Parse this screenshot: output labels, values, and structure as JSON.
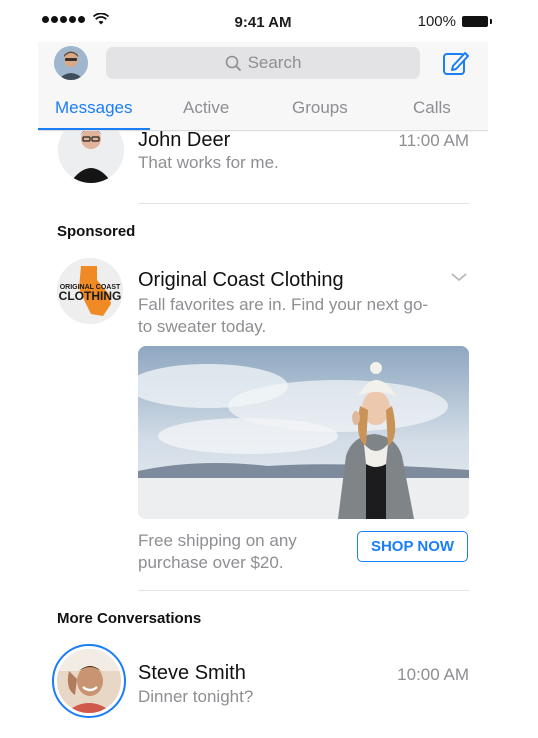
{
  "status_bar": {
    "time": "9:41 AM",
    "battery": "100%"
  },
  "header": {
    "search_placeholder": "Search"
  },
  "tabs": [
    {
      "label": "Messages",
      "active": true
    },
    {
      "label": "Active"
    },
    {
      "label": "Groups"
    },
    {
      "label": "Calls"
    }
  ],
  "conversations_top": [
    {
      "name": "John Deer",
      "preview": "That works for me.",
      "time": "11:00 AM"
    }
  ],
  "sponsored": {
    "section_title": "Sponsored",
    "advertiser": "Original Coast Clothing",
    "logo_text_line1": "ORIGINAL COAST",
    "logo_text_line2": "CLOTHING",
    "body_line1": "Fall favorites are in. Find your next go-",
    "body_line2": "to sweater today.",
    "footer_line1": "Free shipping on any",
    "footer_line2": "purchase over $20.",
    "cta": "SHOP NOW"
  },
  "more": {
    "section_title": "More Conversations",
    "items": [
      {
        "name": "Steve Smith",
        "preview": "Dinner tonight?",
        "time": "10:00 AM"
      }
    ]
  },
  "colors": {
    "accent": "#1b7ef5",
    "muted": "#8e8e93",
    "logo_orange": "#f08a24"
  }
}
